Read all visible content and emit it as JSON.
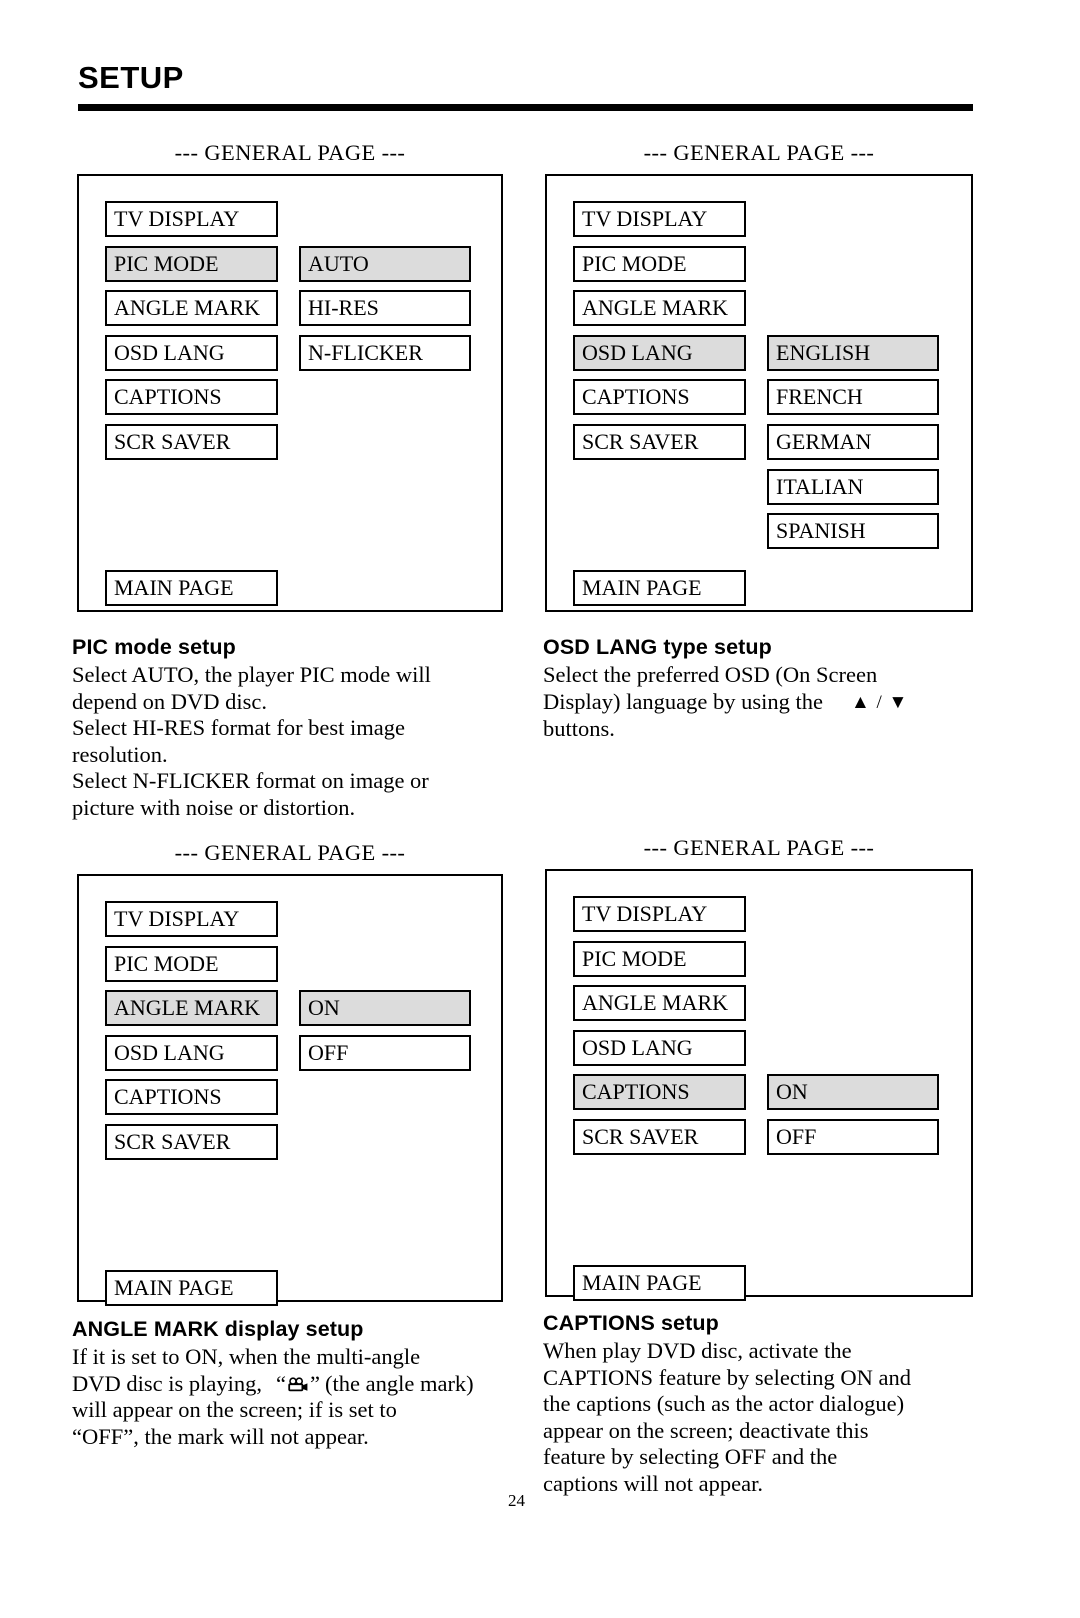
{
  "header": {
    "title": "SETUP"
  },
  "page_number": "24",
  "panels": [
    {
      "caption": "--- GENERAL PAGE ---",
      "menu": [
        {
          "label": "TV DISPLAY",
          "highlighted": false
        },
        {
          "label": "PIC MODE",
          "highlighted": true
        },
        {
          "label": "ANGLE MARK",
          "highlighted": false
        },
        {
          "label": "OSD LANG",
          "highlighted": false
        },
        {
          "label": "CAPTIONS",
          "highlighted": false
        },
        {
          "label": "SCR SAVER",
          "highlighted": false
        }
      ],
      "options": [
        {
          "label": "AUTO",
          "highlighted": true
        },
        {
          "label": "HI-RES",
          "highlighted": false
        },
        {
          "label": "N-FLICKER",
          "highlighted": false
        }
      ],
      "options_start_row": 1,
      "main_page": "MAIN PAGE"
    },
    {
      "caption": "--- GENERAL PAGE ---",
      "menu": [
        {
          "label": "TV DISPLAY",
          "highlighted": false
        },
        {
          "label": "PIC MODE",
          "highlighted": false
        },
        {
          "label": "ANGLE MARK",
          "highlighted": false
        },
        {
          "label": "OSD LANG",
          "highlighted": true
        },
        {
          "label": "CAPTIONS",
          "highlighted": false
        },
        {
          "label": "SCR SAVER",
          "highlighted": false
        }
      ],
      "options": [
        {
          "label": "ENGLISH",
          "highlighted": true
        },
        {
          "label": "FRENCH",
          "highlighted": false
        },
        {
          "label": "GERMAN",
          "highlighted": false
        },
        {
          "label": "ITALIAN",
          "highlighted": false
        },
        {
          "label": "SPANISH",
          "highlighted": false
        }
      ],
      "options_start_row": 3,
      "main_page": "MAIN PAGE"
    },
    {
      "caption": "--- GENERAL PAGE ---",
      "menu": [
        {
          "label": "TV DISPLAY",
          "highlighted": false
        },
        {
          "label": "PIC MODE",
          "highlighted": false
        },
        {
          "label": "ANGLE MARK",
          "highlighted": true
        },
        {
          "label": "OSD LANG",
          "highlighted": false
        },
        {
          "label": "CAPTIONS",
          "highlighted": false
        },
        {
          "label": "SCR SAVER",
          "highlighted": false
        }
      ],
      "options": [
        {
          "label": "ON",
          "highlighted": true
        },
        {
          "label": "OFF",
          "highlighted": false
        }
      ],
      "options_start_row": 2,
      "main_page": "MAIN PAGE"
    },
    {
      "caption": "--- GENERAL PAGE ---",
      "menu": [
        {
          "label": "TV DISPLAY",
          "highlighted": false
        },
        {
          "label": "PIC MODE",
          "highlighted": false
        },
        {
          "label": "ANGLE MARK",
          "highlighted": false
        },
        {
          "label": "OSD LANG",
          "highlighted": false
        },
        {
          "label": "CAPTIONS",
          "highlighted": true
        },
        {
          "label": "SCR SAVER",
          "highlighted": false
        }
      ],
      "options": [
        {
          "label": "ON",
          "highlighted": true
        },
        {
          "label": "OFF",
          "highlighted": false
        }
      ],
      "options_start_row": 4,
      "main_page": "MAIN PAGE"
    }
  ],
  "sections": {
    "pic_mode": {
      "heading": "PIC mode setup",
      "lines": [
        "Select AUTO, the player PIC mode will",
        "depend on DVD disc.",
        "Select HI-RES format for best image",
        "resolution.",
        "Select N-FLICKER format on image or",
        "picture with noise or distortion."
      ]
    },
    "osd_lang": {
      "heading": "OSD LANG type setup",
      "line1": "Select the preferred OSD (On Screen",
      "line2_before": "Display) language by using the",
      "arrows": "▲ / ▼",
      "line3": "buttons."
    },
    "angle_mark": {
      "heading": "ANGLE MARK display setup",
      "line1": "If it is set to ON, when the multi-angle",
      "line2_before": "DVD disc is playing,",
      "line2_quote_open": "“",
      "line2_quote_close": "”",
      "line2_after": "(the angle mark)",
      "line3": "will appear on the screen; if is set to",
      "line4": "“OFF”, the mark will not appear."
    },
    "captions": {
      "heading": "CAPTIONS setup",
      "lines": [
        "When play DVD disc, activate the",
        "CAPTIONS feature by selecting ON and",
        "the captions (such as the actor dialogue)",
        "appear on the screen; deactivate this",
        "feature by selecting OFF and the",
        "captions will not appear."
      ]
    }
  }
}
